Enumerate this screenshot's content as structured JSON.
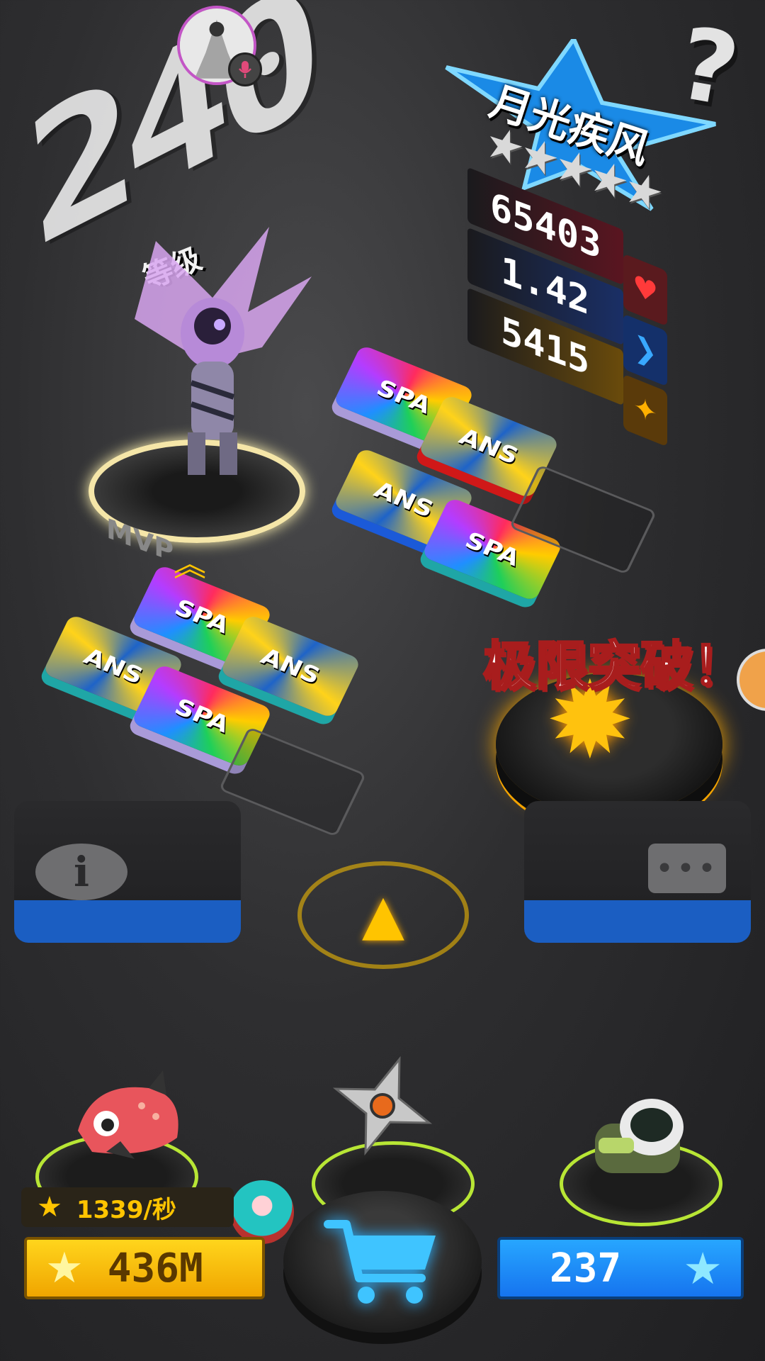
{
  "level": {
    "number": "240",
    "label": "等级"
  },
  "character": {
    "name": "月光疾风",
    "stars": 5,
    "stars_text": "★★★★★",
    "badge_label": "MVP"
  },
  "stats": {
    "hp": "65403",
    "speed": "1.42",
    "attack": "5415",
    "icons": [
      "heart-icon",
      "chevron-right-icon",
      "star-icon"
    ]
  },
  "tiles": {
    "ans_label": "ANS",
    "spa_label": "SPA"
  },
  "limit_break": {
    "label": "极限突破！"
  },
  "currency": {
    "rate": "1339/秒",
    "gold": "436M",
    "gems": "237"
  },
  "colors": {
    "gold": "#ffc400",
    "gem_blue": "#1674ef",
    "hp_red": "#ff3a3a",
    "speed_blue": "#39a8ff",
    "limit_red": "#a81d1d",
    "pedestal_green": "#b8e635"
  }
}
